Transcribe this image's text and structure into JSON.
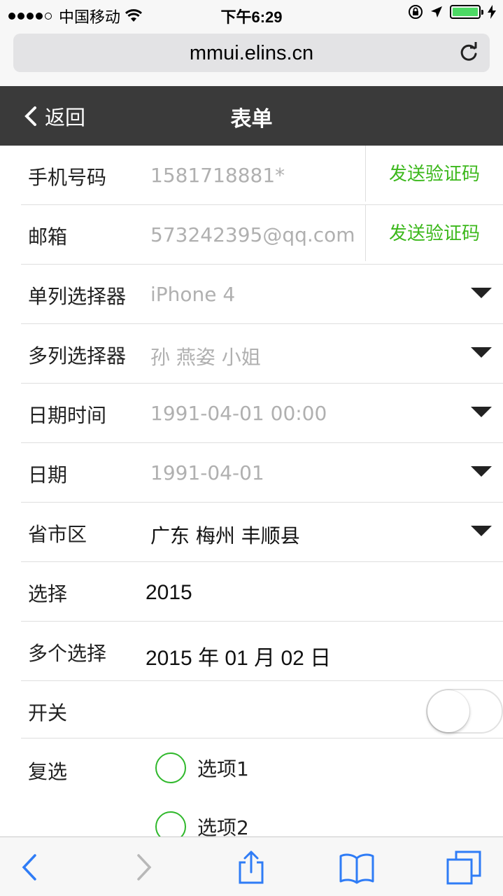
{
  "status_bar": {
    "carrier": "中国移动",
    "time": "下午6:29",
    "battery_color": "#4cd964"
  },
  "browser": {
    "url": "mmui.elins.cn",
    "reload_icon": "reload-icon"
  },
  "nav": {
    "back_label": "返回",
    "title": "表单"
  },
  "form": {
    "phone": {
      "label": "手机号码",
      "placeholder": "1581718881*",
      "action": "发送验证码"
    },
    "email": {
      "label": "邮箱",
      "placeholder": "573242395@qq.com",
      "action": "发送验证码"
    },
    "single_picker": {
      "label": "单列选择器",
      "value": "iPhone 4"
    },
    "multi_picker": {
      "label": "多列选择器",
      "value": "孙 燕姿 小姐"
    },
    "datetime": {
      "label": "日期时间",
      "value": "1991-04-01 00:00"
    },
    "date": {
      "label": "日期",
      "value": "1991-04-01"
    },
    "region": {
      "label": "省市区",
      "value": "广东 梅州 丰顺县"
    },
    "select": {
      "label": "选择",
      "value": "2015"
    },
    "multi_select": {
      "label": "多个选择",
      "value": "2015 年 01 月 02 日"
    },
    "switch": {
      "label": "开关",
      "on": false
    },
    "checkbox": {
      "label": "复选",
      "options": [
        "选项1",
        "选项2"
      ]
    }
  },
  "colors": {
    "accent_green": "#3cb81c",
    "nav_bg": "#3a3a3a"
  }
}
